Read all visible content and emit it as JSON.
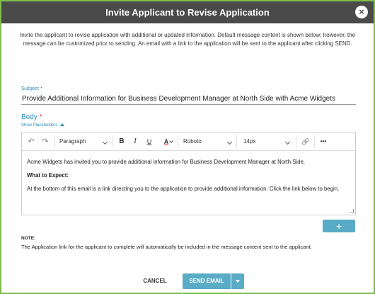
{
  "modal": {
    "title": "Invite Applicant to Revise Application",
    "close_icon": "×"
  },
  "intro": "Invite the applicant to revise application with additional or updated information. Default message content is shown below; however, the message can be customized prior to sending. An email with a link to the application will be sent to the applicant after clicking SEND.",
  "subject": {
    "label": "Subject",
    "required_mark": "*",
    "value": "Provide Additional Information for Business Development Manager at North Side with Acme Widgets"
  },
  "body": {
    "label": "Body",
    "required_mark": "*",
    "show_placeholders": "Show Placeholders"
  },
  "toolbar": {
    "undo": "↶",
    "redo": "↷",
    "block_format": "Paragraph",
    "bold": "B",
    "italic": "I",
    "underline": "U",
    "text_color": "A",
    "font_family": "Roboto",
    "font_size": "14px",
    "link": "🔗",
    "more": "•••"
  },
  "editor_content": {
    "line1": "Acme Widgets has invited you to provide additional information for Business Development Manager at North Side.",
    "heading": "What to Expect:",
    "line2": "At the bottom of this email is a link directing you to the application to provide additional information. Click the link below to begin."
  },
  "add_button": "+",
  "note": {
    "label": "NOTE:",
    "text": "The Application link for the applicant to complete will automatically be included in the message content sent to the applicant."
  },
  "footer": {
    "cancel": "CANCEL",
    "send": "SEND EMAIL"
  },
  "colors": {
    "header_bg": "#4a4a4a",
    "accent": "#5aabc6",
    "label_blue": "#2a8cb8",
    "border_green": "#7fbf4d"
  }
}
